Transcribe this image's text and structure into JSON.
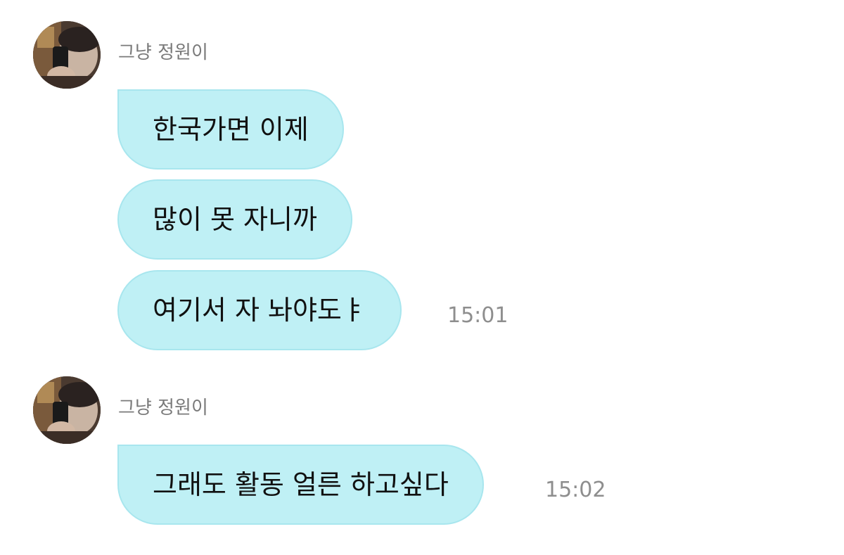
{
  "messages": [
    {
      "sender": "그냥 정원이",
      "bubbles": [
        "한국가면 이제",
        "많이 못 자니까",
        "여기서 자 놔야도ㅑ"
      ],
      "time": "15:01"
    },
    {
      "sender": "그냥 정원이",
      "bubbles": [
        "그래도 활동 얼른 하고싶다"
      ],
      "time": "15:02"
    }
  ],
  "colors": {
    "bubble": "#bff0f5",
    "bubble_border": "#a8e6ee",
    "sender_name": "#7a7a7a",
    "timestamp": "#8e8e8e"
  },
  "icons": {
    "avatar": "profile-photo"
  }
}
